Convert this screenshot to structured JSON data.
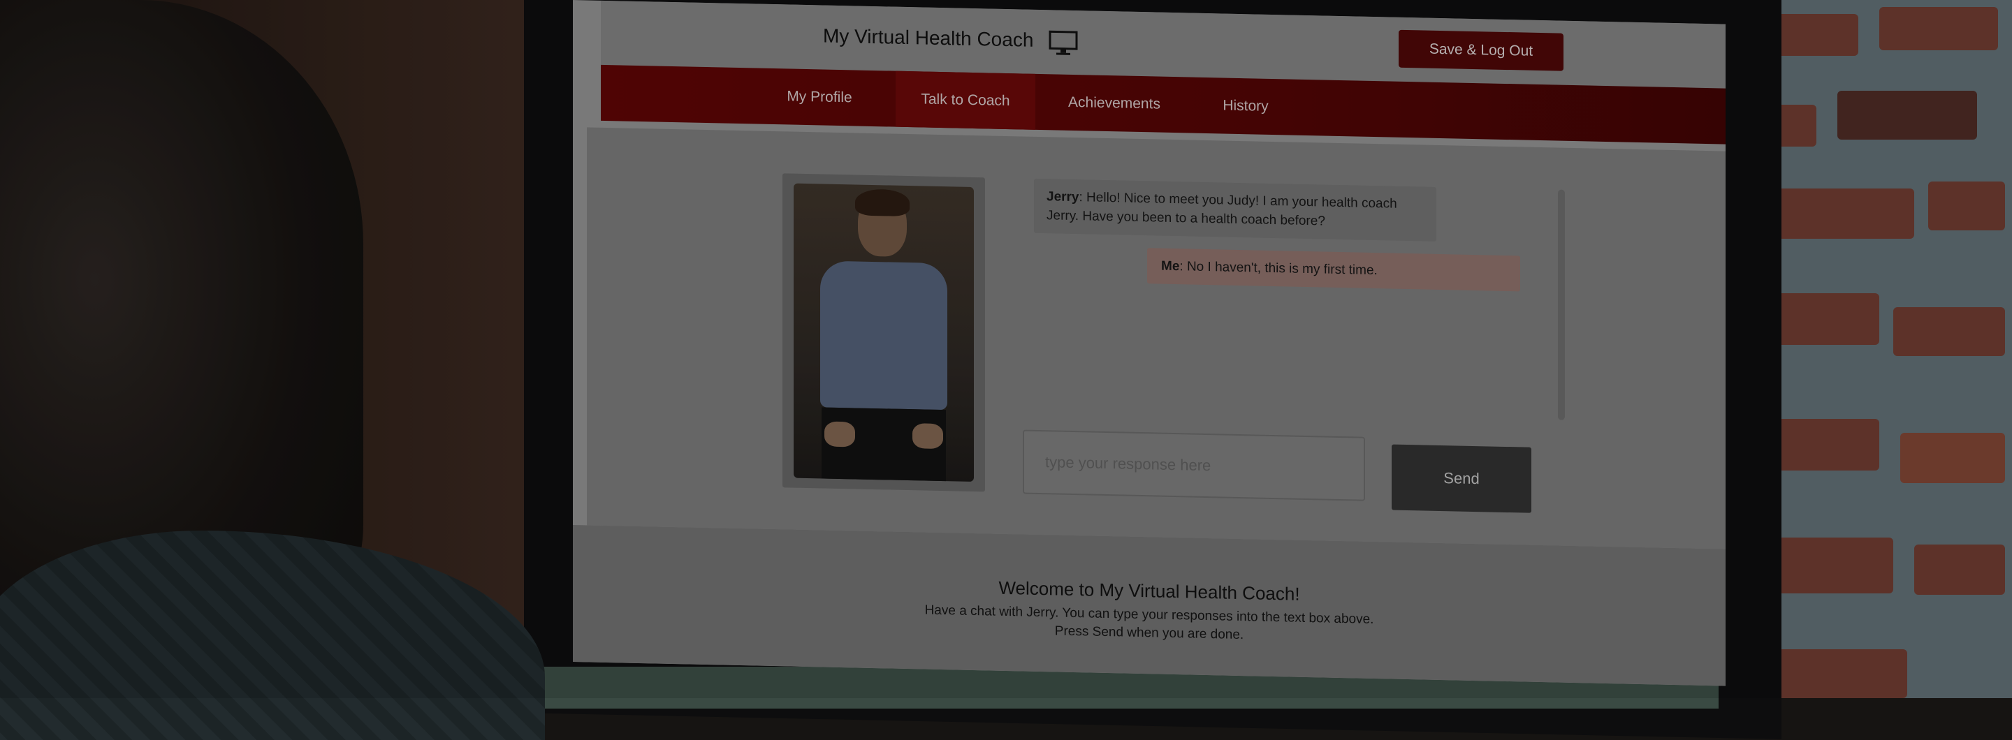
{
  "app": {
    "title": "My Virtual Health Coach",
    "save_button": "Save & Log Out"
  },
  "nav": {
    "items": [
      {
        "label": "My Profile"
      },
      {
        "label": "Talk to Coach",
        "active": true
      },
      {
        "label": "Achievements"
      },
      {
        "label": "History"
      }
    ]
  },
  "chat": {
    "messages": [
      {
        "speaker": "Jerry",
        "text": ": Hello! Nice to meet you Judy! I am your health coach Jerry. Have you been to a health coach before?"
      },
      {
        "speaker": "Me",
        "text": ": No I haven't, this is my first time."
      }
    ],
    "input_placeholder": "type your response here",
    "send_button": "Send"
  },
  "footer": {
    "title": "Welcome to My Virtual Health Coach!",
    "line1": "Have a chat with Jerry. You can type your responses into the text box above.",
    "line2": "Press Send when you are done."
  },
  "colors": {
    "brand_red": "#5a0505",
    "active_tab": "#650909",
    "save_button": "#4a0707"
  },
  "icons": {
    "monitor": "monitor-icon"
  }
}
